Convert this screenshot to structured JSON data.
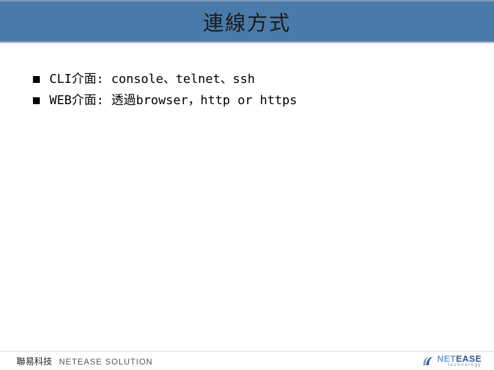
{
  "title": "連線方式",
  "bullets": [
    "CLI介面: console、telnet、ssh",
    "WEB介面: 透過browser，http or https"
  ],
  "footer": {
    "company_cn": "聯易科技",
    "company_en": "NETEASE SOLUTION",
    "logo_top_a": "NET",
    "logo_top_b": "EASE",
    "logo_sub": "technology"
  }
}
